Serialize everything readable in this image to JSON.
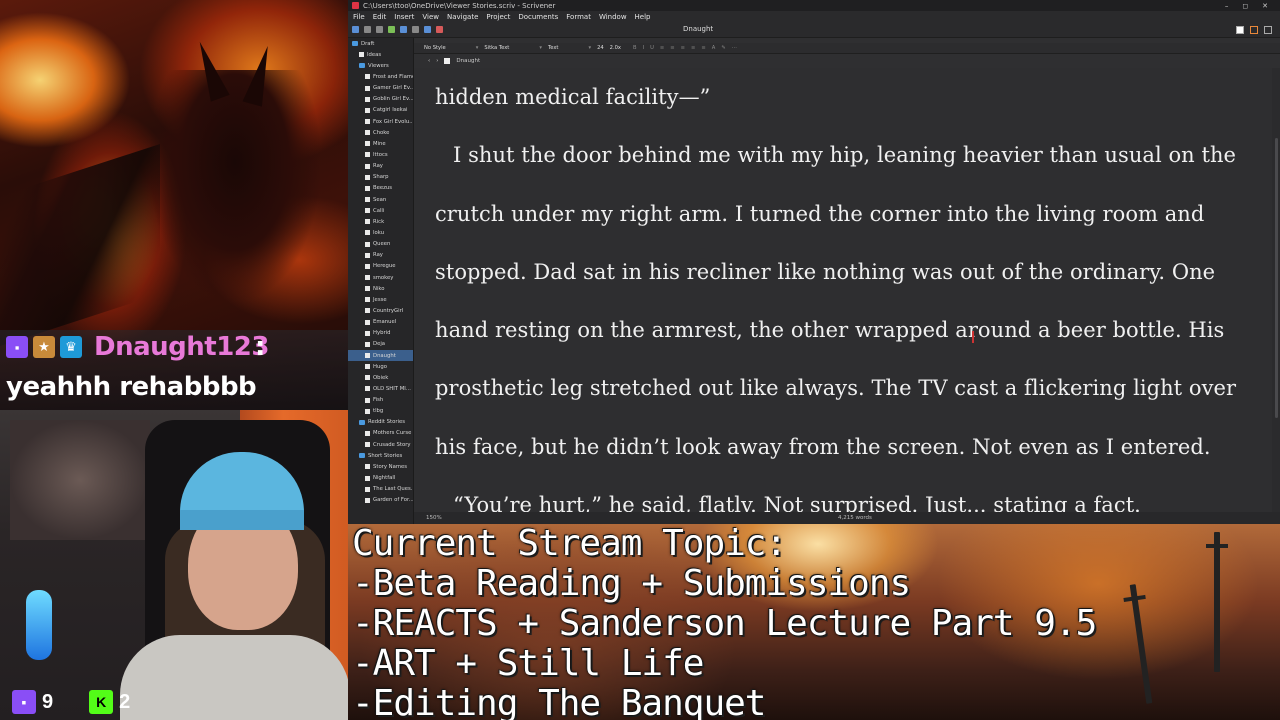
{
  "chat": {
    "username": "Dnaught123",
    "colon": ":",
    "message": "yeahhh rehabbbb"
  },
  "stream_stats": {
    "twitch_viewers": "9",
    "kick_viewers": "2",
    "kick_letter": "K"
  },
  "window": {
    "title": "C:\\Users\\ttoo\\OneDrive\\Viewer Stories.scriv - Scrivener",
    "controls": [
      "–",
      "◻",
      "✕"
    ]
  },
  "menu": [
    "File",
    "Edit",
    "Insert",
    "View",
    "Navigate",
    "Project",
    "Documents",
    "Format",
    "Window",
    "Help"
  ],
  "toolbar": {
    "document_title": "Dnaught"
  },
  "format_bar": {
    "style": "No Style",
    "font": "Sitka Text",
    "face": "Text",
    "size": "24",
    "spacing": "2.0x",
    "icons": [
      "B",
      "I",
      "U",
      "≡",
      "≡",
      "≡",
      "≡",
      "≡",
      "A",
      "✎",
      "⋯"
    ]
  },
  "breadcrumb": {
    "doc": "Dnaught"
  },
  "binder": [
    {
      "label": "Draft",
      "level": 0,
      "type": "folder"
    },
    {
      "label": "Ideas",
      "level": 1,
      "type": "doc"
    },
    {
      "label": "Viewers",
      "level": 1,
      "type": "folder"
    },
    {
      "label": "Frost and Flame",
      "level": 2,
      "type": "doc"
    },
    {
      "label": "Gamer Girl Ev...",
      "level": 2,
      "type": "doc"
    },
    {
      "label": "Goblin Girl Ev...",
      "level": 2,
      "type": "doc"
    },
    {
      "label": "Catgirl Isekai",
      "level": 2,
      "type": "doc"
    },
    {
      "label": "Fox Girl Evolu...",
      "level": 2,
      "type": "doc"
    },
    {
      "label": "Choke",
      "level": 2,
      "type": "doc"
    },
    {
      "label": "Mine",
      "level": 2,
      "type": "doc"
    },
    {
      "label": "Ittocs",
      "level": 2,
      "type": "doc"
    },
    {
      "label": "Ray",
      "level": 2,
      "type": "doc"
    },
    {
      "label": "Sharp",
      "level": 2,
      "type": "doc"
    },
    {
      "label": "Beezus",
      "level": 2,
      "type": "doc"
    },
    {
      "label": "Sean",
      "level": 2,
      "type": "doc"
    },
    {
      "label": "Calli",
      "level": 2,
      "type": "doc"
    },
    {
      "label": "Rick",
      "level": 2,
      "type": "doc"
    },
    {
      "label": "Ioku",
      "level": 2,
      "type": "doc"
    },
    {
      "label": "Queen",
      "level": 2,
      "type": "doc"
    },
    {
      "label": "Ray",
      "level": 2,
      "type": "doc"
    },
    {
      "label": "Heregue",
      "level": 2,
      "type": "doc"
    },
    {
      "label": "smokey",
      "level": 2,
      "type": "doc"
    },
    {
      "label": "Niko",
      "level": 2,
      "type": "doc"
    },
    {
      "label": "Jesse",
      "level": 2,
      "type": "doc"
    },
    {
      "label": "CountryGirl",
      "level": 2,
      "type": "doc"
    },
    {
      "label": "Emanuel",
      "level": 2,
      "type": "doc"
    },
    {
      "label": "Hybrid",
      "level": 2,
      "type": "doc"
    },
    {
      "label": "Deja",
      "level": 2,
      "type": "doc"
    },
    {
      "label": "Dnaught",
      "level": 2,
      "type": "doc",
      "selected": true
    },
    {
      "label": "Hugo",
      "level": 2,
      "type": "doc"
    },
    {
      "label": "Obiek",
      "level": 2,
      "type": "doc"
    },
    {
      "label": "OLD SHIT MI...",
      "level": 2,
      "type": "doc"
    },
    {
      "label": "Fish",
      "level": 2,
      "type": "doc"
    },
    {
      "label": "tlbg",
      "level": 2,
      "type": "doc"
    },
    {
      "label": "Reddit Stories",
      "level": 1,
      "type": "folder"
    },
    {
      "label": "Mothers Curse",
      "level": 2,
      "type": "doc"
    },
    {
      "label": "Crusade Story",
      "level": 2,
      "type": "doc"
    },
    {
      "label": "Short Stories",
      "level": 1,
      "type": "folder"
    },
    {
      "label": "Story Names",
      "level": 2,
      "type": "doc"
    },
    {
      "label": "Nightfall",
      "level": 2,
      "type": "doc"
    },
    {
      "label": "The Last Ques...",
      "level": 2,
      "type": "doc"
    },
    {
      "label": "Garden of For...",
      "level": 2,
      "type": "doc"
    }
  ],
  "editor": {
    "lines": [
      {
        "text": "hidden medical facility—”",
        "indent": false
      },
      {
        "text": "I shut the door behind me with my hip, leaning heavier than usual on the",
        "indent": true
      },
      {
        "text": "crutch under my right arm. I turned the corner into the living room and",
        "indent": false
      },
      {
        "text": "stopped. Dad sat in his recliner like nothing was out of the ordinary. One",
        "indent": false
      },
      {
        "text": "hand resting on the armrest, the other wrapped around a beer bottle. His",
        "indent": false
      },
      {
        "text": "prosthetic leg stretched out like always. The TV cast a flickering light over",
        "indent": false
      },
      {
        "text": "his face, but he didn’t look away from the screen. Not even as I entered.",
        "indent": false
      },
      {
        "text": "“You’re hurt,” he said, flatly. Not surprised. Just... stating a fact.",
        "indent": true
      }
    ]
  },
  "status": {
    "zoom": "150%",
    "word_count": "4,215 words"
  },
  "banner": {
    "lines": [
      "Current Stream Topic:",
      "-Beta Reading + Submissions",
      "-REACTS + Sanderson Lecture Part 9.5",
      "-ART + Still Life",
      "-Editing The Banquet"
    ]
  },
  "colors": {
    "username": "#e879d8",
    "twitch": "#8a4ef6",
    "kick": "#53fc18",
    "editor_bg": "#2e2e30",
    "binder_selected": "#3b5f8c"
  }
}
